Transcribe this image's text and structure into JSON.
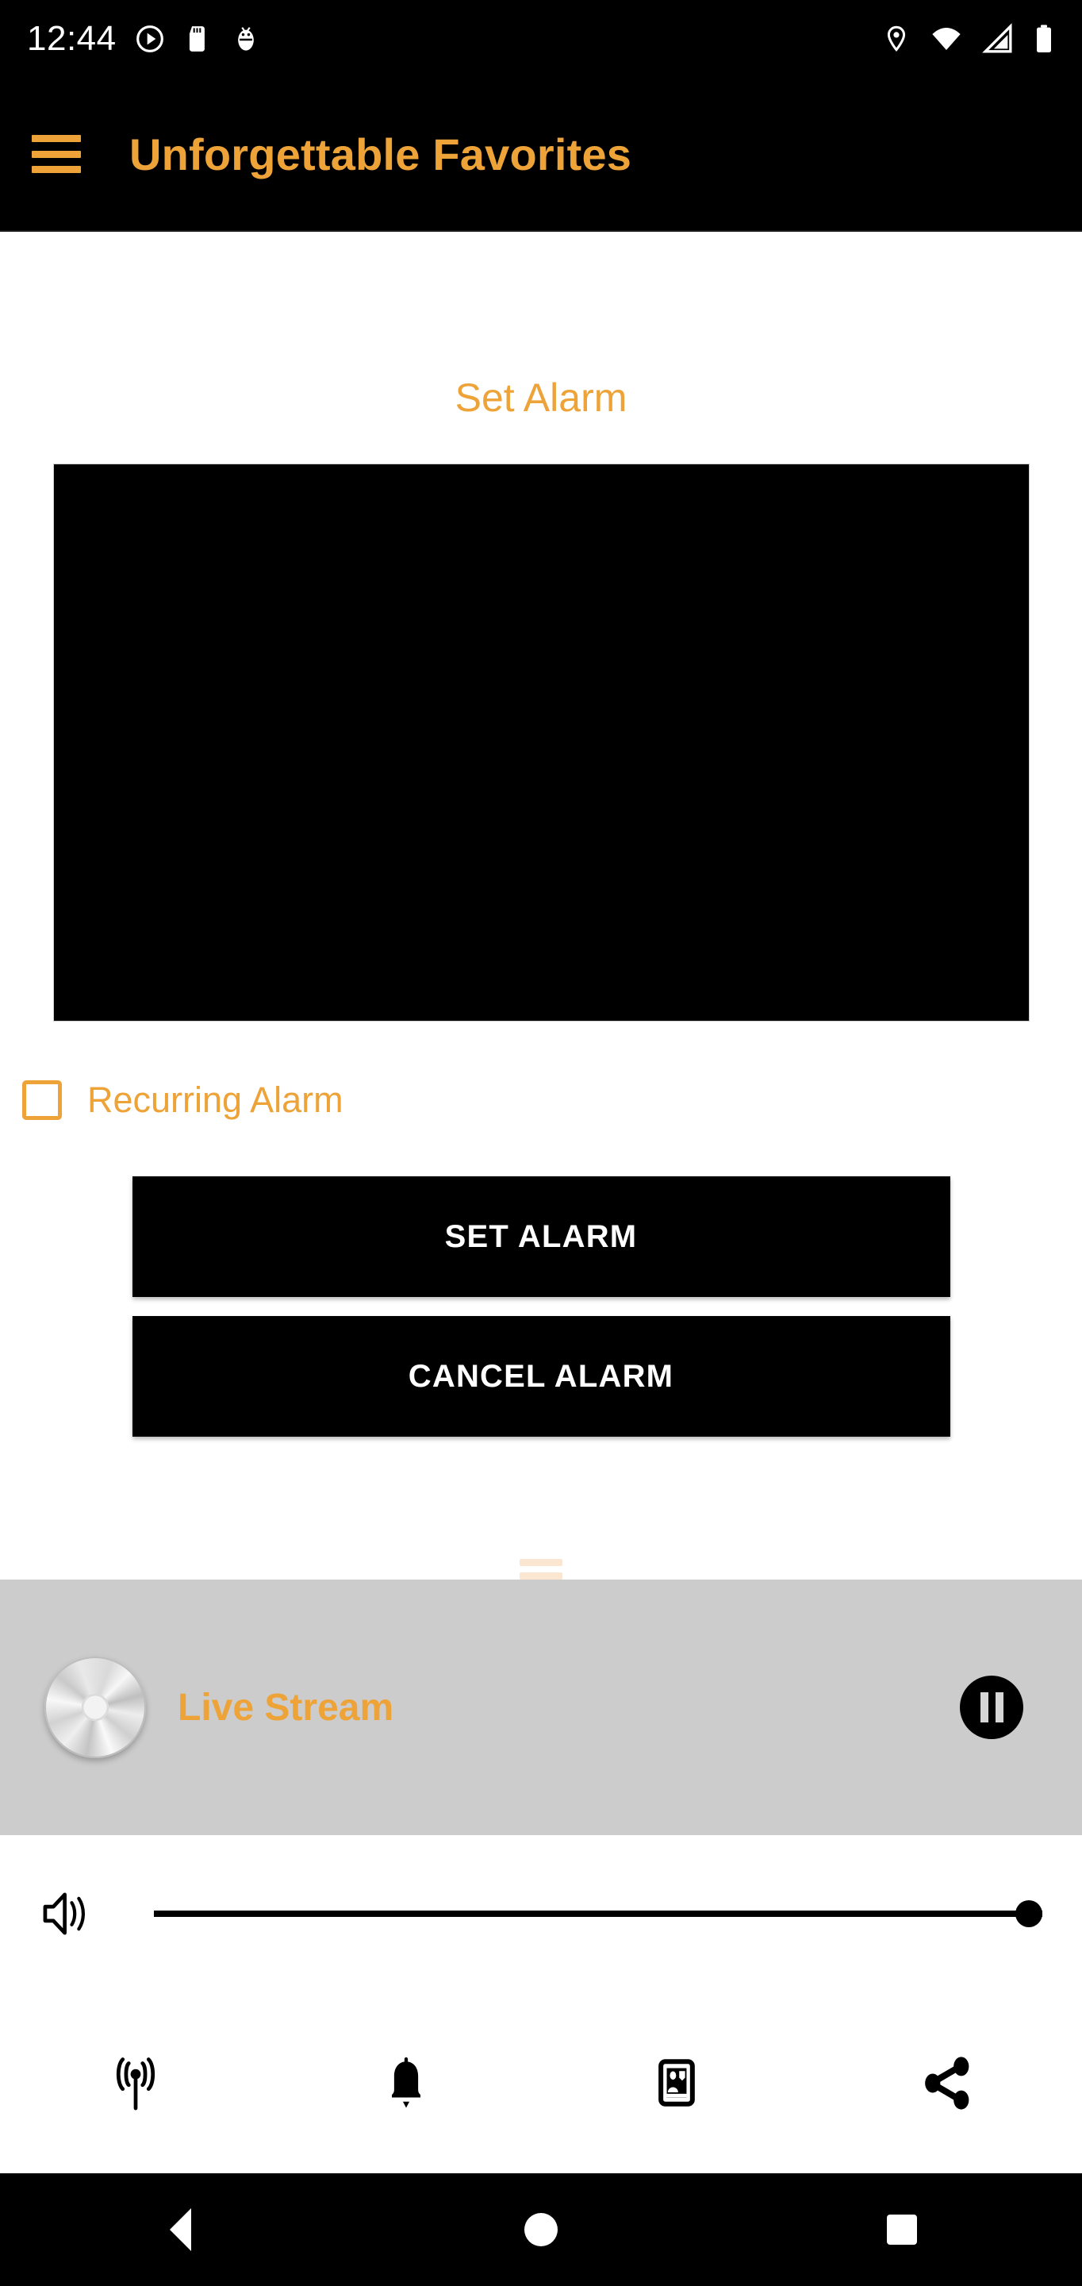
{
  "status_bar": {
    "clock": "12:44",
    "left_icons": [
      "play-circle-icon",
      "sd-card-icon",
      "android-debug-icon"
    ],
    "right_icons": [
      "location-icon",
      "wifi-icon",
      "cellular-signal-icon",
      "battery-icon"
    ],
    "background": "#000000",
    "foreground": "#ffffff"
  },
  "app_bar": {
    "menu_icon": "hamburger-menu-icon",
    "title": "Unforgettable Favorites",
    "title_color": "#EDA338",
    "background": "#000000"
  },
  "main": {
    "section_title": "Set Alarm",
    "time_picker": {
      "name": "alarm-time-picker",
      "background": "#000000"
    },
    "recurring": {
      "label": "Recurring Alarm",
      "checked": false,
      "color": "#EDA338"
    },
    "buttons": [
      {
        "name": "set-alarm-button",
        "label": "SET ALARM"
      },
      {
        "name": "cancel-alarm-button",
        "label": "CANCEL ALARM"
      }
    ]
  },
  "player": {
    "drag_handle": "drag-handle",
    "artwork_icon": "compact-disc-icon",
    "track_title": "Live Stream",
    "track_title_color": "#EDA338",
    "play_state": "playing",
    "play_pause_icon": "pause-icon",
    "background": "#cccccc"
  },
  "volume": {
    "icon": "speaker-volume-icon",
    "value": 100,
    "min": 0,
    "max": 100
  },
  "bottom_tabs": [
    {
      "name": "tab-broadcast",
      "icon": "broadcast-antenna-icon"
    },
    {
      "name": "tab-alarm",
      "icon": "bell-icon"
    },
    {
      "name": "tab-contact",
      "icon": "contact-card-icon"
    },
    {
      "name": "tab-share",
      "icon": "share-icon"
    }
  ],
  "android_nav": [
    {
      "name": "nav-back-button",
      "icon": "triangle-back-icon"
    },
    {
      "name": "nav-home-button",
      "icon": "circle-home-icon"
    },
    {
      "name": "nav-recents-button",
      "icon": "square-recents-icon"
    }
  ],
  "theme": {
    "accent": "#EDA338",
    "handle": "#FBE6D2",
    "player_bg": "#cccccc",
    "dark": "#000000"
  }
}
